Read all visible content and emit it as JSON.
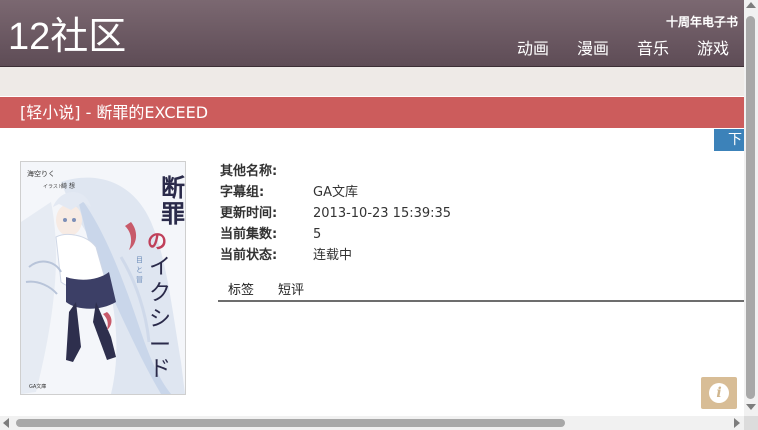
{
  "header": {
    "logo": "12社区",
    "promo": "十周年电子书",
    "nav": [
      "动画",
      "漫画",
      "音乐",
      "游戏"
    ]
  },
  "title": "[轻小说] - 断罪的EXCEED",
  "download_label": "下",
  "info": {
    "rows": [
      {
        "label": "其他名称:",
        "value": ""
      },
      {
        "label": "字幕组:",
        "value": "GA文库"
      },
      {
        "label": "更新时间:",
        "value": "2013-10-23 15:39:35"
      },
      {
        "label": "当前集数:",
        "value": "5"
      },
      {
        "label": "当前状态:",
        "value": "连载中"
      }
    ]
  },
  "tabs": [
    "标签",
    "短评"
  ],
  "cover": {
    "title_glyphs": "断罪のイクシード",
    "author": "海空りく",
    "illustrator": "綺 想",
    "publisher": "GA文庫",
    "icon": "book-cover-image"
  },
  "info_button_icon": "info-icon",
  "colors": {
    "header": "#6e5b64",
    "title_bar": "#cc5c5c",
    "download": "#3c82b9",
    "band": "#eeeae7",
    "info_button": "#d8bd96"
  }
}
